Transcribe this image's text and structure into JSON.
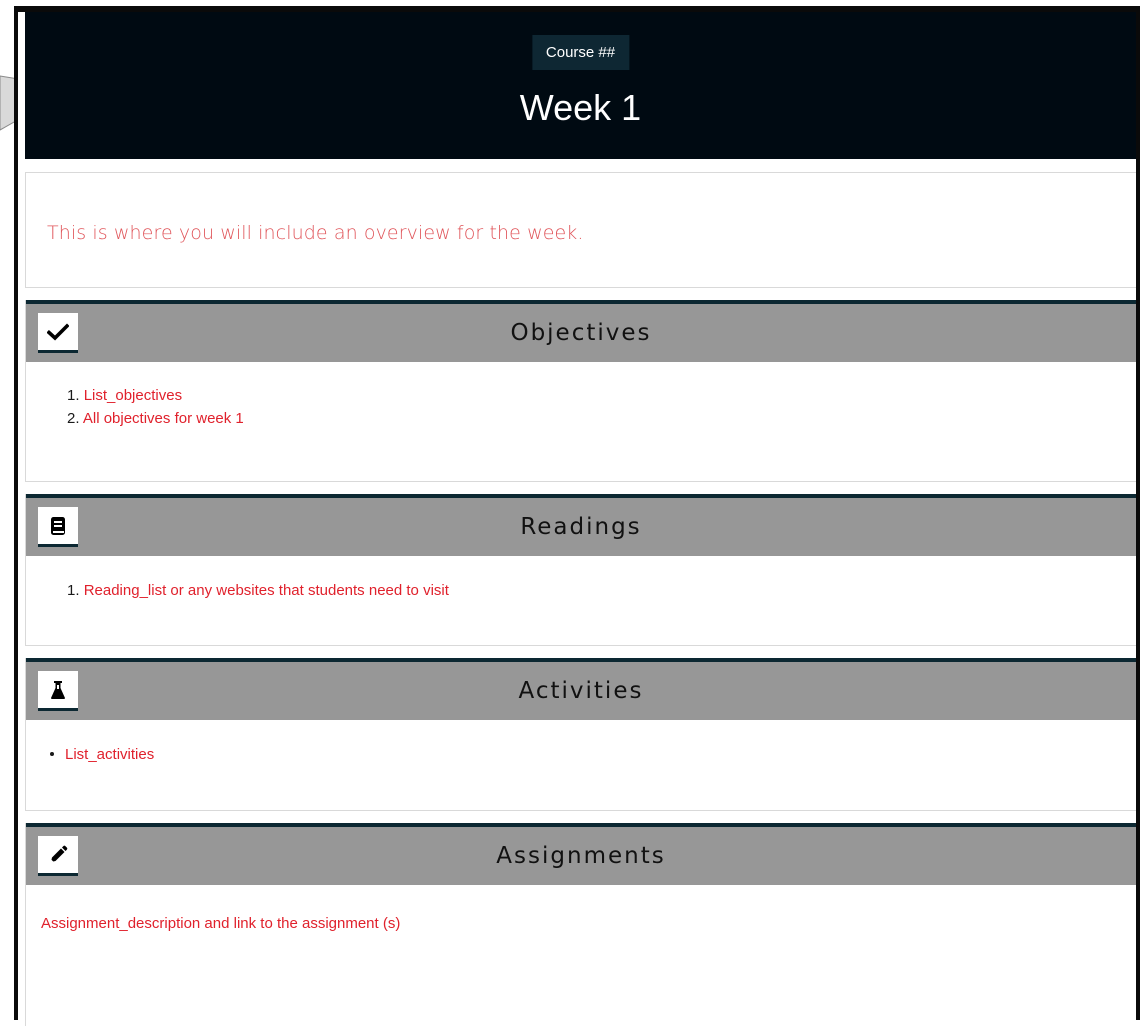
{
  "banner": {
    "course_label": "Course ##",
    "week_title": "Week 1"
  },
  "overview": {
    "text": "This is where you will include an overview for the week."
  },
  "sections": {
    "objectives": {
      "title": "Objectives",
      "icon": "checkmark-icon",
      "items": [
        {
          "number": "1.",
          "text": "List_objectives"
        },
        {
          "number": "2.",
          "text": "All objectives for week 1"
        }
      ]
    },
    "readings": {
      "title": "Readings",
      "icon": "book-icon",
      "items": [
        {
          "number": "1.",
          "text": "Reading_list or any websites that students need to visit"
        }
      ]
    },
    "activities": {
      "title": "Activities",
      "icon": "flask-icon",
      "items": [
        {
          "text": "List_activities"
        }
      ]
    },
    "assignments": {
      "title": "Assignments",
      "icon": "pencil-icon",
      "text": "Assignment_description and link to the assignment (s)"
    }
  },
  "colors": {
    "banner_background": "#000a12",
    "badge_background": "#0e2733",
    "section_header_background": "#979797",
    "section_accent": "#0c2832",
    "link_red": "#e0212c",
    "overview_text": "#e0555a"
  }
}
